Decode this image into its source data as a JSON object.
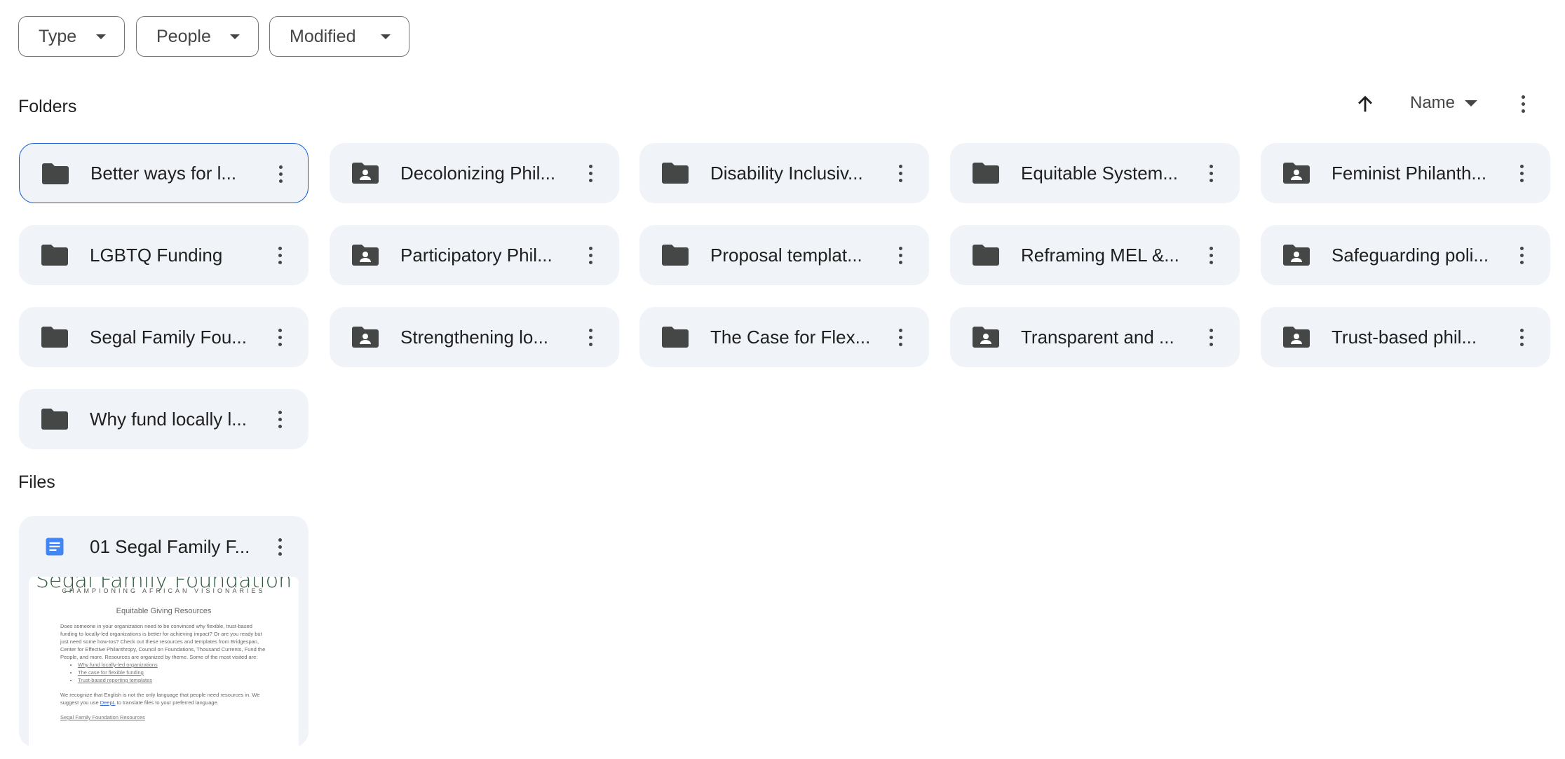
{
  "filters": [
    {
      "label": "Type"
    },
    {
      "label": "People"
    },
    {
      "label": "Modified"
    }
  ],
  "folders_section": {
    "title": "Folders",
    "sort_label": "Name",
    "sort_direction": "ascending"
  },
  "folders": [
    {
      "name": "Better ways for l...",
      "shared": false,
      "selected": true
    },
    {
      "name": "Decolonizing Phil...",
      "shared": true
    },
    {
      "name": "Disability Inclusiv...",
      "shared": false
    },
    {
      "name": "Equitable System...",
      "shared": false
    },
    {
      "name": "Feminist Philanth...",
      "shared": true
    },
    {
      "name": "LGBTQ Funding",
      "shared": false
    },
    {
      "name": "Participatory Phil...",
      "shared": true
    },
    {
      "name": "Proposal templat...",
      "shared": false
    },
    {
      "name": "Reframing MEL &...",
      "shared": false
    },
    {
      "name": "Safeguarding poli...",
      "shared": true
    },
    {
      "name": "Segal Family Fou...",
      "shared": false
    },
    {
      "name": "Strengthening lo...",
      "shared": true
    },
    {
      "name": "The Case for Flex...",
      "shared": false
    },
    {
      "name": "Transparent and ...",
      "shared": true
    },
    {
      "name": "Trust-based phil...",
      "shared": true
    },
    {
      "name": "Why fund locally l...",
      "shared": false
    }
  ],
  "files_section": {
    "title": "Files"
  },
  "files": [
    {
      "name": "01 Segal Family F...",
      "type": "google-doc",
      "icon_color": "#4285f4",
      "preview": {
        "logo": "Segal Family Foundation",
        "tagline": "CHAMPIONING AFRICAN VISIONARIES",
        "heading": "Equitable Giving Resources",
        "intro": "Does someone in your organization need to be convinced why flexible, trust-based funding to locally-led organizations is better for achieving impact? Or are you ready but just need some how-tos? Check out these resources and templates from Bridgespan, Center for Effective Philanthropy, Council on Foundations, Thousand Currents, Fund the People, and more. Resources are organized by theme. Some of the most visited are:",
        "links": [
          "Why fund locally-led organizations",
          "The case for flexible funding",
          "Trust-based reporting templates"
        ],
        "lang_before": "We recognize that English is not the only language that people need resources in. We suggest you use ",
        "lang_link": "DeepL",
        "lang_after": " to translate files to your preferred language.",
        "section_link": "Segal Family Foundation Resources"
      }
    }
  ]
}
